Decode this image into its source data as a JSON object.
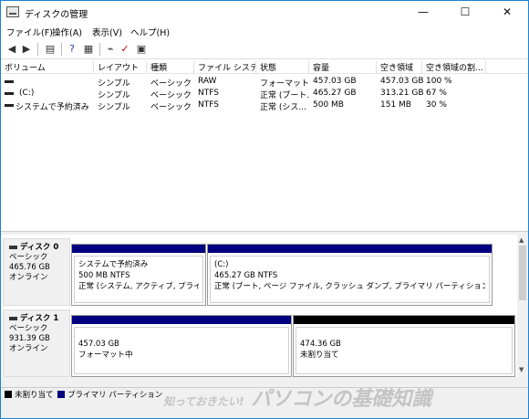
{
  "window": {
    "title": "ディスクの管理",
    "minimize": "—",
    "maximize": "☐",
    "close": "✕"
  },
  "menu": [
    "ファイル(F)",
    "操作(A)",
    "表示(V)",
    "ヘルプ(H)"
  ],
  "toolbar_icons": [
    "back-icon",
    "forward-icon",
    "properties-icon",
    "help-icon",
    "list-view-icon",
    "connect-icon",
    "check-icon",
    "refresh-icon"
  ],
  "volume_table": {
    "headers": [
      "ボリューム",
      "レイアウト",
      "種類",
      "ファイル システム",
      "状態",
      "容量",
      "空き領域",
      "空き領域の割..."
    ],
    "rows": [
      [
        "",
        "シンプル",
        "ベーシック",
        "RAW",
        "フォーマット中",
        "457.03 GB",
        "457.03 GB",
        "100 %"
      ],
      [
        "(C:)",
        "シンプル",
        "ベーシック",
        "NTFS",
        "正常 (ブート...",
        "465.27 GB",
        "313.21 GB",
        "67 %"
      ],
      [
        "システムで予約済み",
        "シンプル",
        "ベーシック",
        "NTFS",
        "正常 (シス...",
        "500 MB",
        "151 MB",
        "30 %"
      ]
    ]
  },
  "disks": [
    {
      "name": "ディスク 0",
      "type": "ベーシック",
      "size": "465.76 GB",
      "status": "オンライン",
      "partitions": [
        {
          "title": "システムで予約済み",
          "line1": "500 MB NTFS",
          "line2": "正常 (システム, アクティブ, プライマリ パ",
          "bar": "#000080"
        },
        {
          "title": "(C:)",
          "line1": "465.27 GB NTFS",
          "line2": "正常 (ブート, ページ ファイル, クラッシュ ダンプ, プライマリ パーティション)",
          "bar": "#000080"
        }
      ]
    },
    {
      "name": "ディスク 1",
      "type": "ベーシック",
      "size": "931.39 GB",
      "status": "オンライン",
      "partitions": [
        {
          "title": "",
          "line1": "457.03 GB",
          "line2": "フォーマット中",
          "bar": "#000080"
        },
        {
          "title": "",
          "line1": "474.36 GB",
          "line2": "未割り当て",
          "bar": "#000000"
        }
      ]
    }
  ],
  "legend": [
    {
      "label": "未割り当て",
      "color": "#000000"
    },
    {
      "label": "プライマリ パーティション",
      "color": "#000080"
    }
  ],
  "watermark": {
    "small": "知っておきたい!",
    "big": "パソコンの基礎知識"
  }
}
